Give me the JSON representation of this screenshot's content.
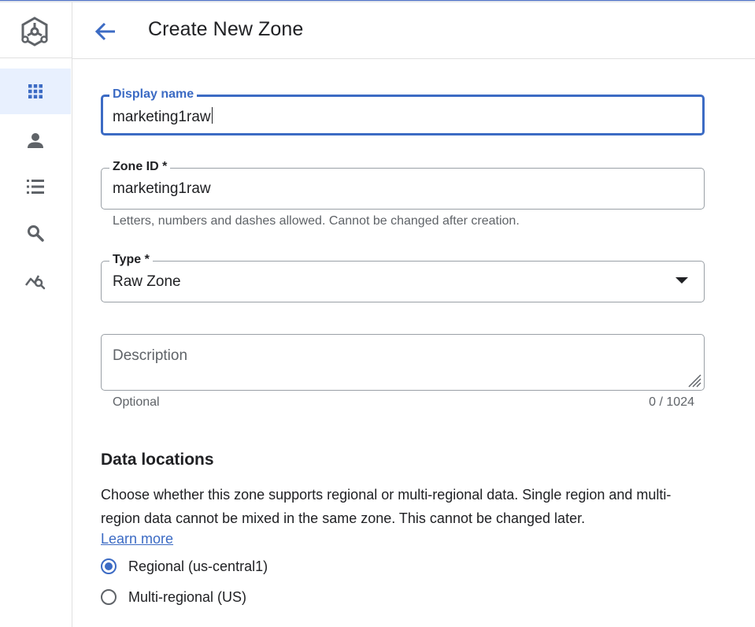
{
  "header": {
    "title": "Create New Zone",
    "back_icon": "arrow-back-icon"
  },
  "rail": {
    "logo_icon": "dataplex-logo-icon",
    "items": [
      {
        "icon": "apps-grid-icon",
        "active": true
      },
      {
        "icon": "person-icon",
        "active": false
      },
      {
        "icon": "list-icon",
        "active": false
      },
      {
        "icon": "search-icon",
        "active": false
      },
      {
        "icon": "analytics-search-icon",
        "active": false
      }
    ]
  },
  "form": {
    "display_name": {
      "label": "Display name",
      "value": "marketing1raw"
    },
    "zone_id": {
      "label": "Zone ID *",
      "value": "marketing1raw",
      "hint": "Letters, numbers and dashes allowed. Cannot be changed after creation."
    },
    "type": {
      "label": "Type *",
      "value": "Raw Zone"
    },
    "description": {
      "placeholder": "Description",
      "hint": "Optional",
      "counter": "0 / 1024"
    }
  },
  "data_locations": {
    "title": "Data locations",
    "description": "Choose whether this zone supports regional or multi-regional data. Single region and multi-region data cannot be mixed in the same zone. This cannot be changed later.",
    "learn_more": "Learn more",
    "options": [
      {
        "label": "Regional (us-central1)",
        "selected": true
      },
      {
        "label": "Multi-regional (US)",
        "selected": false
      }
    ]
  },
  "colors": {
    "accent": "#3c6bc4",
    "rail_active_bg": "#e8f0fe",
    "icon_gray": "#5f6368"
  }
}
